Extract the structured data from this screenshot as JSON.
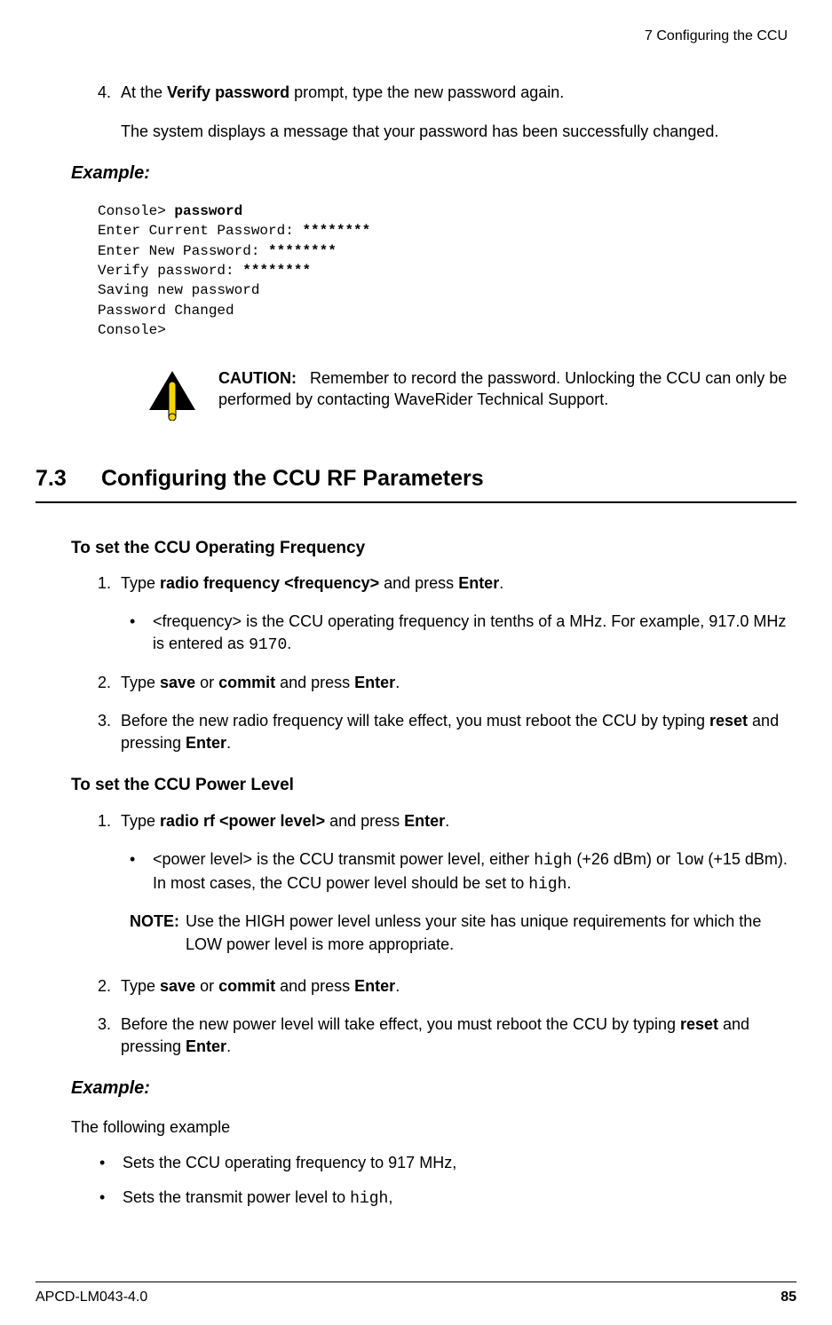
{
  "header": {
    "chapter": "7  Configuring the CCU"
  },
  "step4": {
    "num": "4.",
    "prefix": "At the ",
    "bold1": "Verify password",
    "suffix": " prompt, type the new password again."
  },
  "step4_para": "The system displays a message that your password has been successfully changed.",
  "example_label": "Example:",
  "console": {
    "l1a": "Console> ",
    "l1b": "password",
    "l2a": "Enter Current Password: ",
    "l2b": "********",
    "l3a": "Enter New Password: ",
    "l3b": "********",
    "l4a": "Verify password: ",
    "l4b": "********",
    "l5": "Saving new password",
    "l6": "Password Changed",
    "l7": "Console>"
  },
  "caution": {
    "label": "CAUTION:",
    "text": "Remember to record the password. Unlocking the CCU can only be performed by contacting WaveRider Technical Support."
  },
  "section": {
    "num": "7.3",
    "title": "Configuring the CCU RF Parameters"
  },
  "sub1": "To set the CCU Operating Frequency",
  "s1_1": {
    "num": "1.",
    "a": "Type ",
    "b": "radio frequency <frequency>",
    "c": " and press ",
    "d": "Enter",
    "e": "."
  },
  "s1_bullet": {
    "a": "<frequency> is the CCU operating frequency in tenths of a MHz. For example, 917.0 MHz is entered as ",
    "mono": "9170",
    "b": "."
  },
  "s1_2": {
    "num": "2.",
    "a": "Type ",
    "b": "save",
    "c": " or ",
    "d": "commit",
    "e": " and press ",
    "f": "Enter",
    "g": "."
  },
  "s1_3": {
    "num": "3.",
    "a": "Before the new radio frequency will take effect, you must reboot the CCU by typing ",
    "b": "reset",
    "c": " and pressing ",
    "d": "Enter",
    "e": "."
  },
  "sub2": "To set the CCU Power Level",
  "s2_1": {
    "num": "1.",
    "a": "Type ",
    "b": "radio rf <power level>",
    "c": " and press ",
    "d": "Enter",
    "e": "."
  },
  "s2_bullet": {
    "a": "<power level> is the CCU transmit power level, either ",
    "m1": "high",
    "b": " (+26 dBm) or ",
    "m2": "low",
    "c": " (+15 dBm). In most cases, the CCU power level should be set to ",
    "m3": "high",
    "d": "."
  },
  "note": {
    "label": "NOTE:",
    "text": "Use the HIGH power level unless your site has unique requirements for which the LOW power level is more appropriate."
  },
  "s2_2": {
    "num": "2.",
    "a": "Type ",
    "b": "save",
    "c": " or ",
    "d": "commit",
    "e": " and press ",
    "f": "Enter",
    "g": "."
  },
  "s2_3": {
    "num": "3.",
    "a": "Before the new power level will take effect, you must reboot the CCU by typing ",
    "b": "reset",
    "c": " and pressing ",
    "d": "Enter",
    "e": "."
  },
  "example2_label": "Example:",
  "ex2_para": "The following example",
  "ex2_b1": "Sets the CCU operating frequency to 917 MHz,",
  "ex2_b2a": "Sets the transmit power level to ",
  "ex2_b2m": "high",
  "ex2_b2b": ",",
  "footer": {
    "left": "APCD-LM043-4.0",
    "right": "85"
  }
}
